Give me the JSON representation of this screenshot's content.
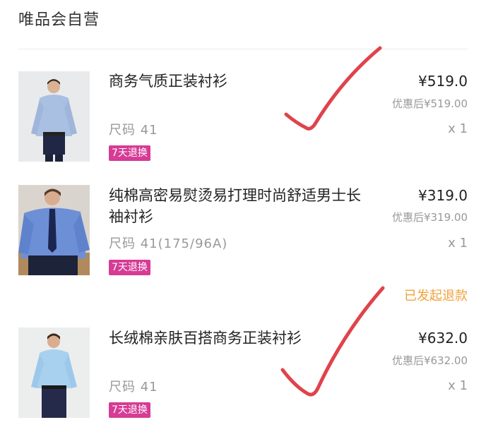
{
  "store": {
    "title": "唯品会自营"
  },
  "items": [
    {
      "name": "商务气质正装衬衫",
      "price": "¥519.0",
      "after_discount": "优惠后¥519.00",
      "size": "尺码  41",
      "qty": "x 1",
      "badge": "7天退换"
    },
    {
      "name": "纯棉高密易熨烫易打理时尚舒适男士长袖衬衫",
      "price": "¥319.0",
      "after_discount": "优惠后¥319.00",
      "size": "尺码  41(175/96A)",
      "qty": "x 1",
      "badge": "7天退换",
      "refund_status": "已发起退款"
    },
    {
      "name": "长绒棉亲肤百搭商务正装衬衫",
      "price": "¥632.0",
      "after_discount": "优惠后¥632.00",
      "size": "尺码  41",
      "qty": "x 1",
      "badge": "7天退换"
    }
  ],
  "colors": {
    "badge": "#d63b95",
    "refund": "#f0a23b",
    "check_mark": "#e0434b"
  },
  "icons": [
    "checkmark-icon"
  ]
}
